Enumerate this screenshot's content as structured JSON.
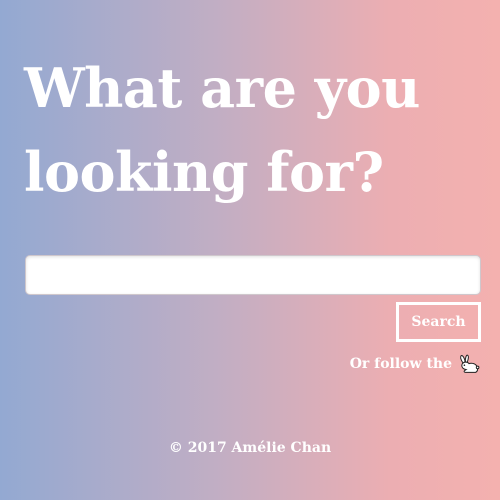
{
  "heading": {
    "line1": "What are you",
    "line2": "looking for?"
  },
  "search": {
    "value": "",
    "placeholder": "",
    "button_label": "Search"
  },
  "follow": {
    "text": "Or follow the",
    "icon": "rabbit-icon"
  },
  "footer": {
    "copyright": "© 2017 Amélie Chan"
  },
  "colors": {
    "gradient_left": "#93a9d2",
    "gradient_right": "#f4b1af",
    "text": "#ffffff"
  }
}
